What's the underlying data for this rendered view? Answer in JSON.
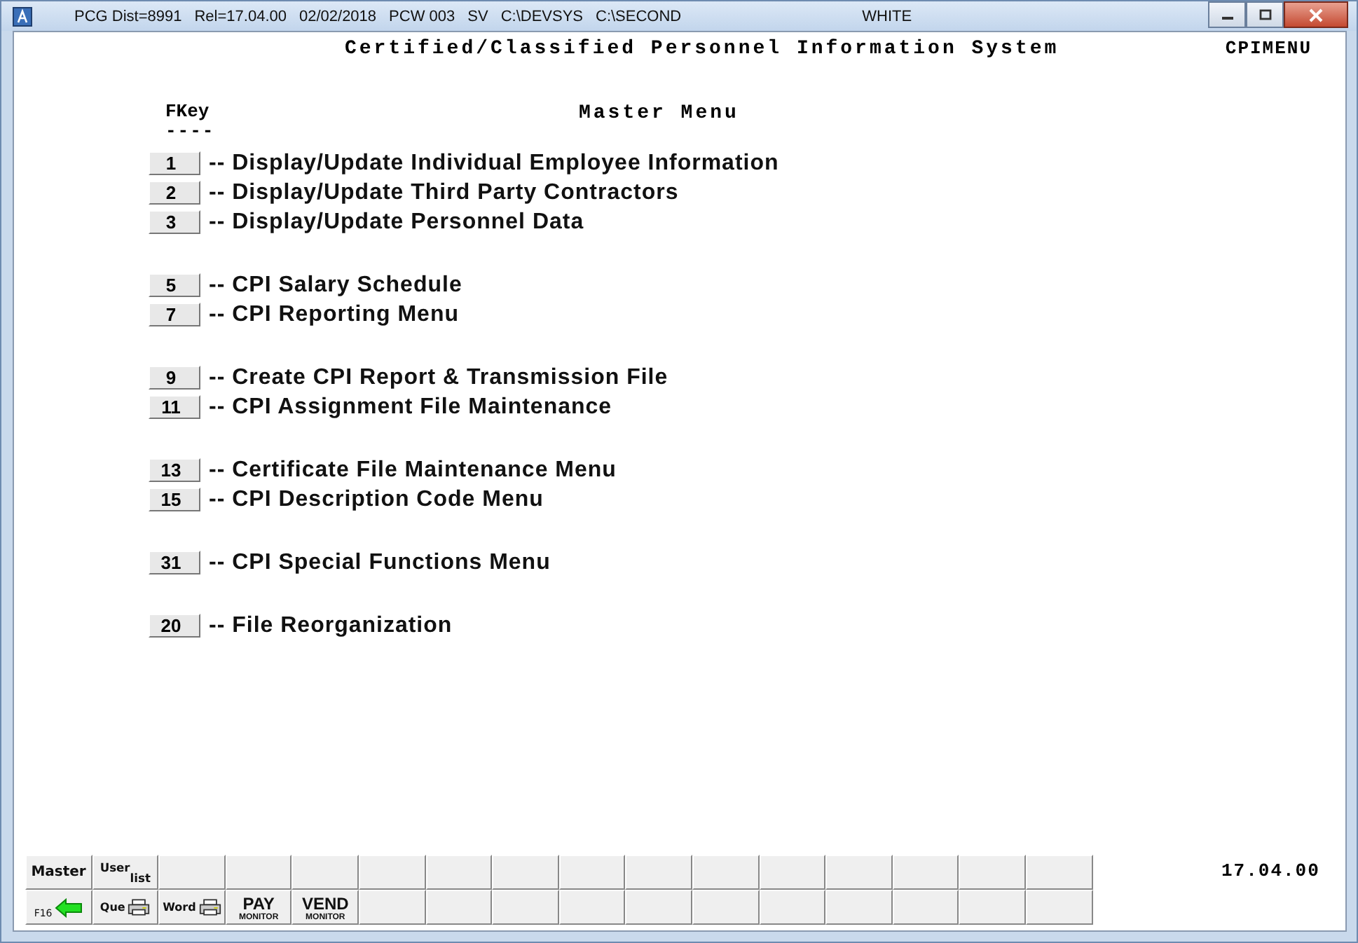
{
  "window": {
    "title_parts": [
      "PCG Dist=8991",
      "Rel=17.04.00",
      "02/02/2018",
      "PCW 003",
      "SV",
      "C:\\DEVSYS",
      "C:\\SECOND"
    ],
    "title_extra": "WHITE"
  },
  "header": {
    "title": "Certified/Classified Personnel Information System",
    "screen_id": "CPIMENU"
  },
  "menu": {
    "fkey_heading": "FKey",
    "fkey_rule": "----",
    "title": "Master Menu",
    "groups": [
      {
        "items": [
          {
            "key": "1",
            "label": "-- Display/Update Individual Employee Information"
          },
          {
            "key": "2",
            "label": "-- Display/Update Third Party Contractors"
          },
          {
            "key": "3",
            "label": "-- Display/Update Personnel Data"
          }
        ]
      },
      {
        "items": [
          {
            "key": "5",
            "label": "-- CPI Salary Schedule"
          },
          {
            "key": "7",
            "label": "-- CPI Reporting Menu"
          }
        ]
      },
      {
        "items": [
          {
            "key": "9",
            "label": "-- Create CPI Report & Transmission File"
          },
          {
            "key": "11",
            "label": "-- CPI Assignment File Maintenance"
          }
        ]
      },
      {
        "items": [
          {
            "key": "13",
            "label": "-- Certificate File Maintenance Menu"
          },
          {
            "key": "15",
            "label": "-- CPI Description Code Menu"
          }
        ]
      },
      {
        "items": [
          {
            "key": "31",
            "label": "-- CPI Special Functions Menu"
          }
        ]
      },
      {
        "items": [
          {
            "key": "20",
            "label": "-- File Reorganization"
          }
        ]
      }
    ]
  },
  "function_keys": [
    {
      "keys": [
        {
          "kind": "text",
          "label": "Master"
        },
        {
          "kind": "text",
          "label": "$^{User}$$_{list}$"
        },
        {
          "kind": "blank"
        },
        {
          "kind": "blank"
        },
        {
          "kind": "blank"
        },
        {
          "kind": "blank"
        },
        {
          "kind": "blank"
        },
        {
          "kind": "blank"
        },
        {
          "kind": "blank"
        },
        {
          "kind": "blank"
        },
        {
          "kind": "blank"
        },
        {
          "kind": "blank"
        },
        {
          "kind": "blank"
        },
        {
          "kind": "blank"
        },
        {
          "kind": "blank"
        },
        {
          "kind": "blank"
        }
      ]
    },
    {
      "keys": [
        {
          "kind": "back",
          "label": "F16"
        },
        {
          "kind": "print",
          "label": "Que"
        },
        {
          "kind": "print",
          "label": "Word"
        },
        {
          "kind": "monitor",
          "label": "PAY",
          "sublabel": "MONITOR"
        },
        {
          "kind": "monitor",
          "label": "VEND",
          "sublabel": "MONITOR"
        },
        {
          "kind": "blank"
        },
        {
          "kind": "blank"
        },
        {
          "kind": "blank"
        },
        {
          "kind": "blank"
        },
        {
          "kind": "blank"
        },
        {
          "kind": "blank"
        },
        {
          "kind": "blank"
        },
        {
          "kind": "blank"
        },
        {
          "kind": "blank"
        },
        {
          "kind": "blank"
        },
        {
          "kind": "blank"
        }
      ]
    }
  ],
  "version": "17.04.00"
}
